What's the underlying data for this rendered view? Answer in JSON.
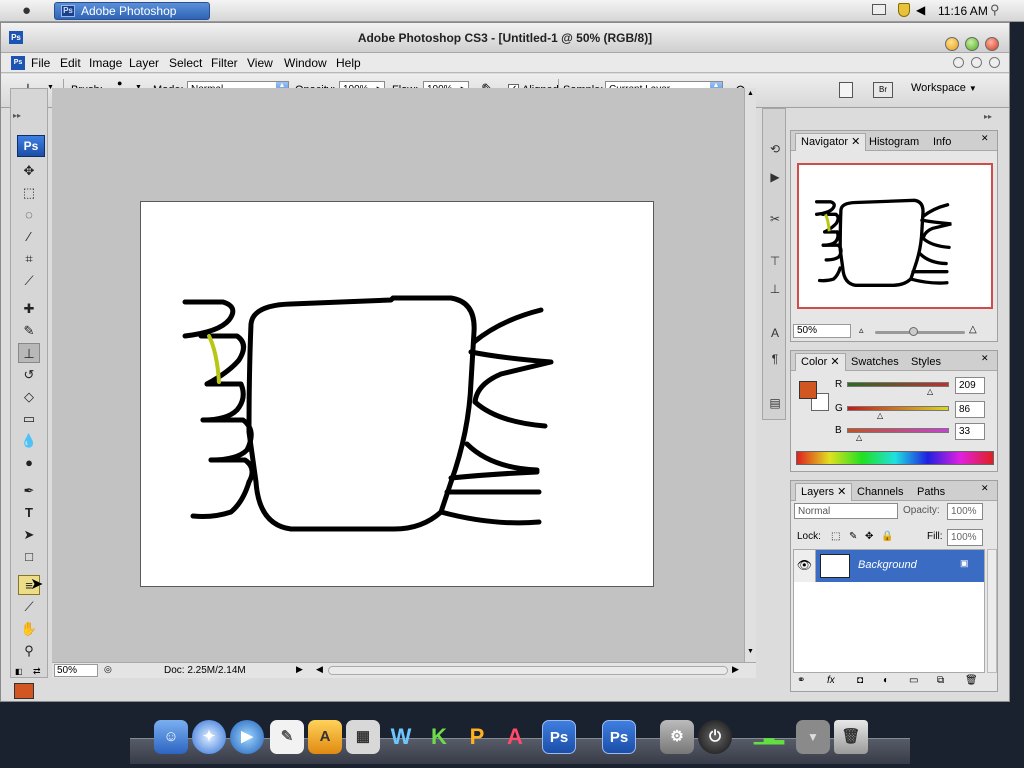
{
  "menubar": {
    "app_button": "Adobe Photoshop CS3...",
    "time": "11:16 AM"
  },
  "window": {
    "title": "Adobe Photoshop CS3 - [Untitled-1 @ 50% (RGB/8)]",
    "menus": [
      "File",
      "Edit",
      "Image",
      "Layer",
      "Select",
      "Filter",
      "View",
      "Window",
      "Help"
    ]
  },
  "options": {
    "brush_label": "Brush:",
    "brush_size": "21",
    "mode_label": "Mode:",
    "mode_value": "Normal",
    "opacity_label": "Opacity:",
    "opacity_value": "100%",
    "flow_label": "Flow:",
    "flow_value": "100%",
    "aligned_label": "Aligned",
    "aligned_checked": true,
    "sample_label": "Sample:",
    "sample_value": "Current Layer",
    "workspace_label": "Workspace"
  },
  "toolbox": {
    "logo": "Ps",
    "tools": [
      "move-tool",
      "marquee-tool",
      "lasso-tool",
      "magic-wand-tool",
      "crop-tool",
      "slice-tool",
      "healing-brush-tool",
      "brush-tool",
      "clone-stamp-tool",
      "history-brush-tool",
      "eraser-tool",
      "gradient-tool",
      "blur-tool",
      "dodge-tool",
      "pen-tool",
      "type-tool",
      "path-selection-tool",
      "shape-tool",
      "notes-tool",
      "eyedropper-tool",
      "hand-tool",
      "zoom-tool"
    ],
    "foreground_color": "#d15621"
  },
  "status": {
    "zoom": "50%",
    "doc": "Doc: 2.25M/2.14M"
  },
  "navigator": {
    "tabs": [
      "Navigator",
      "Histogram",
      "Info"
    ],
    "zoom": "50%"
  },
  "color": {
    "tabs": [
      "Color",
      "Swatches",
      "Styles"
    ],
    "r_label": "R",
    "r_value": "209",
    "g_label": "G",
    "g_value": "86",
    "b_label": "B",
    "b_value": "33",
    "r_level": 0.82,
    "g_level": 0.34,
    "b_level": 0.13,
    "swatch": "#d15621"
  },
  "layers": {
    "tabs": [
      "Layers",
      "Channels",
      "Paths"
    ],
    "blend_mode": "Normal",
    "opacity_label": "Opacity:",
    "opacity_value": "100%",
    "lock_label": "Lock:",
    "fill_label": "Fill:",
    "fill_value": "100%",
    "layer_name": "Background"
  },
  "dock": {
    "apps": [
      "finder",
      "safari",
      "quicktime",
      "textedit",
      "app-store",
      "calculator",
      "ps-app",
      "photoshop",
      "photoshop-cs3",
      "system-prefs",
      "shutdown",
      "activity-monitor",
      "downloads",
      "trash"
    ]
  }
}
